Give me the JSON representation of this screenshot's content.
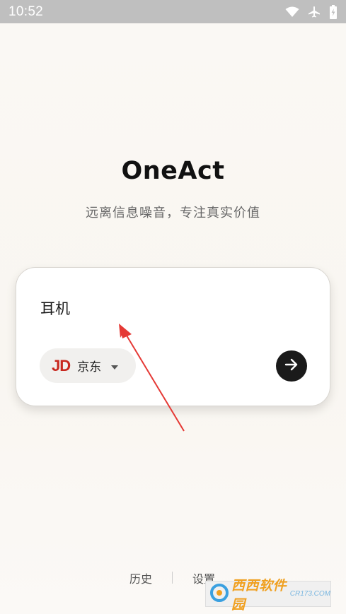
{
  "status_bar": {
    "time": "10:52",
    "icons": [
      "wifi-icon",
      "airplane-mode-icon",
      "battery-charging-icon"
    ]
  },
  "app": {
    "title": "OneAct",
    "subtitle": "远离信息噪音，专注真实价值"
  },
  "search": {
    "query": "耳机",
    "source_logo": "JD",
    "source_label": "京东",
    "submit_icon": "arrow-right-icon"
  },
  "footer": {
    "history_label": "历史",
    "settings_label": "设置"
  },
  "watermark": {
    "brand": "西西软件园",
    "url": "CR173.COM"
  },
  "colors": {
    "background": "#faf8f4",
    "jd_red": "#c8281f",
    "annotation_arrow": "#e53935",
    "button_dark": "#1a1a1a"
  }
}
